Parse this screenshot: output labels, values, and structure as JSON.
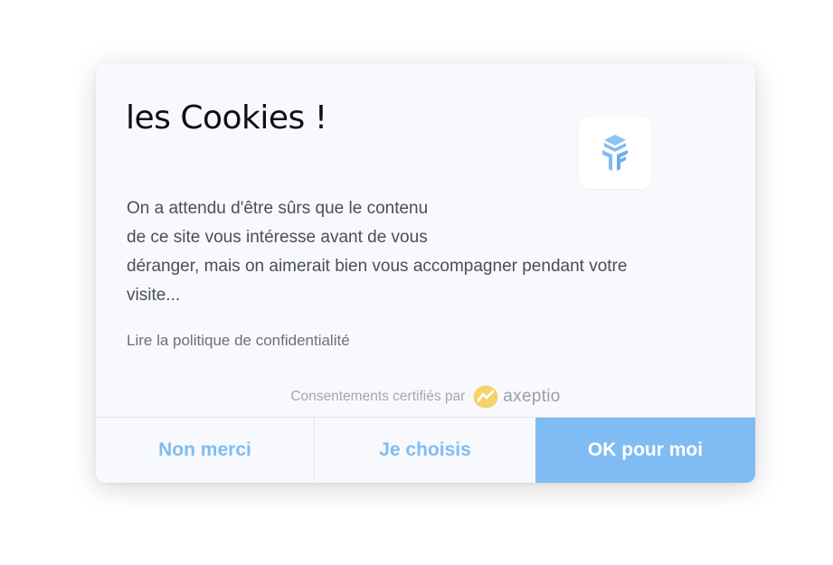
{
  "dialog": {
    "title": "les Cookies !",
    "body_lines": [
      "On a attendu d'être sûrs que le contenu",
      "de ce site vous intéresse avant de vous",
      "déranger, mais on aimerait bien vous accompagner pendant votre",
      "visite..."
    ],
    "policy_link": "Lire la politique de confidentialité",
    "certified_text": "Consentements certifiés par",
    "certified_brand": "axeptio",
    "logo_icon": "site-logo-icon"
  },
  "buttons": {
    "decline": "Non merci",
    "choose": "Je choisis",
    "accept": "OK pour moi"
  },
  "colors": {
    "accent": "#7fbcf3",
    "card_bg": "#f7f9fc",
    "axeptio_yellow": "#f6d36a"
  }
}
